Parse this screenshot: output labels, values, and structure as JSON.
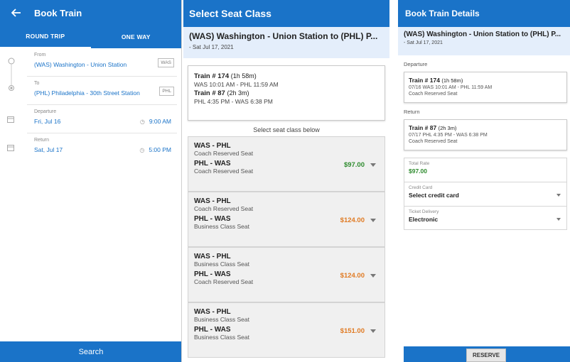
{
  "colors": {
    "brand_blue": "#1a73c8",
    "subheader_bg": "#e4eefb",
    "price_green": "#2e8b2e",
    "price_orange": "#e07b24"
  },
  "book_train": {
    "title": "Book Train",
    "tabs": [
      {
        "label": "ROUND TRIP",
        "active": true
      },
      {
        "label": "ONE WAY",
        "active": false
      }
    ],
    "from": {
      "label": "From",
      "value": "(WAS) Washington - Union Station",
      "code": "WAS"
    },
    "to": {
      "label": "To",
      "value": "(PHL) Philadelphia - 30th Street Station",
      "code": "PHL"
    },
    "departure": {
      "label": "Departure",
      "date": "Fri, Jul 16",
      "time": "9:00 AM"
    },
    "return": {
      "label": "Return",
      "date": "Sat, Jul 17",
      "time": "5:00 PM"
    },
    "search_label": "Search"
  },
  "seat_class": {
    "title": "Select Seat Class",
    "route": "(WAS) Washington - Union Station to (PHL) P...",
    "date": "- Sat Jul 17, 2021",
    "summary": {
      "train1": "Train # 174",
      "train1_dur": "(1h 58m)",
      "train1_times": "WAS 10:01 AM  -  PHL 11:59 AM",
      "train2": "Train # 87",
      "train2_dur": "(2h 3m)",
      "train2_times": "PHL 4:35 PM  -  WAS 6:38 PM"
    },
    "hint": "Select seat class below",
    "options": [
      {
        "leg1": "WAS  -  PHL",
        "class1": "Coach Reserved Seat",
        "leg2": "PHL  -  WAS",
        "class2": "Coach Reserved Seat",
        "price": "$97.00",
        "price_color": "#2e8b2e"
      },
      {
        "leg1": "WAS  -  PHL",
        "class1": "Coach Reserved Seat",
        "leg2": "PHL  -  WAS",
        "class2": "Business Class Seat",
        "price": "$124.00",
        "price_color": "#e07b24"
      },
      {
        "leg1": "WAS  -  PHL",
        "class1": "Business Class Seat",
        "leg2": "PHL  -  WAS",
        "class2": "Coach Reserved Seat",
        "price": "$124.00",
        "price_color": "#e07b24"
      },
      {
        "leg1": "WAS  -  PHL",
        "class1": "Business Class Seat",
        "leg2": "PHL  -  WAS",
        "class2": "Business Class Seat",
        "price": "$151.00",
        "price_color": "#e07b24"
      }
    ]
  },
  "details": {
    "title": "Book Train Details",
    "route": "(WAS) Washington - Union Station to (PHL) P...",
    "date": "- Sat Jul 17, 2021",
    "departure_label": "Departure",
    "departure": {
      "train": "Train # 174",
      "dur": "(1h 58m)",
      "line": "07/16 WAS 10:01 AM  -  PHL 11:59 AM",
      "seat": "Coach Reserved Seat"
    },
    "return_label": "Return",
    "return": {
      "train": "Train # 87",
      "dur": "(2h 3m)",
      "line": "07/17 PHL 4:35 PM  -  WAS 6:38 PM",
      "seat": "Coach Reserved Seat"
    },
    "total_rate_label": "Total Rate",
    "total_rate": "$97.00",
    "credit_card_label": "Credit Card",
    "credit_card_value": "Select credit card",
    "ticket_delivery_label": "Ticket Delivery",
    "ticket_delivery_value": "Electronic",
    "reserve_label": "RESERVE"
  }
}
